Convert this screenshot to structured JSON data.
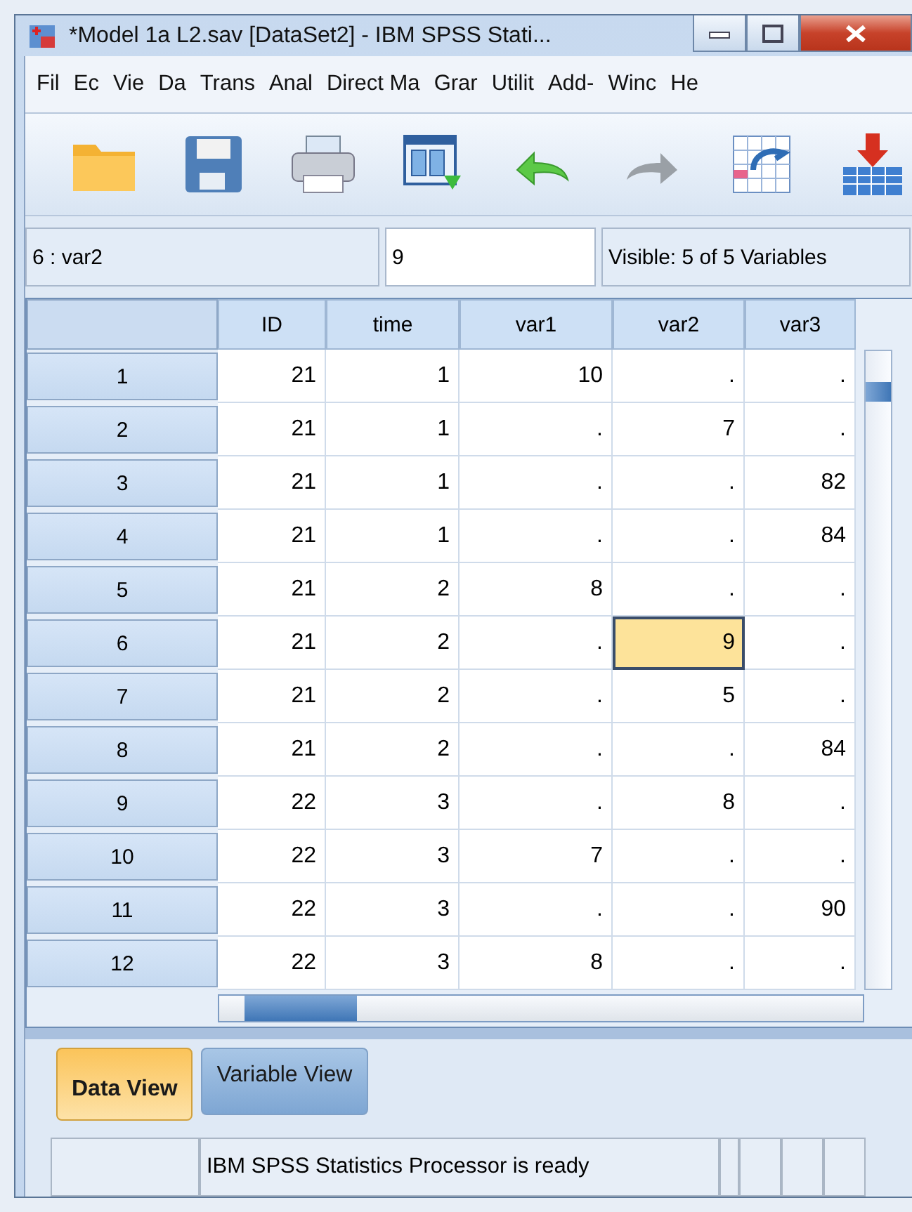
{
  "window": {
    "title": "*Model 1a L2.sav [DataSet2] - IBM SPSS Stati..."
  },
  "menu": [
    "Fil",
    "Ec",
    "Vie",
    "Da",
    "Trans",
    "Anal",
    "Direct Ma",
    "Grar",
    "Utilit",
    "Add-",
    "Winc",
    "He"
  ],
  "cell_info": {
    "reference": "6 : var2",
    "value": "9",
    "visible": "Visible: 5 of 5 Variables"
  },
  "table": {
    "columns": [
      "ID",
      "time",
      "var1",
      "var2",
      "var3"
    ],
    "rows": [
      {
        "label": "1",
        "cells": [
          {
            "text": "21",
            "selected": false
          },
          {
            "text": "1",
            "selected": false
          },
          {
            "text": "10",
            "selected": false
          },
          {
            "text": ".",
            "selected": false
          },
          {
            "text": ".",
            "selected": false
          }
        ]
      },
      {
        "label": "2",
        "cells": [
          {
            "text": "21",
            "selected": false
          },
          {
            "text": "1",
            "selected": false
          },
          {
            "text": ".",
            "selected": false
          },
          {
            "text": "7",
            "selected": false
          },
          {
            "text": ".",
            "selected": false
          }
        ]
      },
      {
        "label": "3",
        "cells": [
          {
            "text": "21",
            "selected": false
          },
          {
            "text": "1",
            "selected": false
          },
          {
            "text": ".",
            "selected": false
          },
          {
            "text": ".",
            "selected": false
          },
          {
            "text": "82",
            "selected": false
          }
        ]
      },
      {
        "label": "4",
        "cells": [
          {
            "text": "21",
            "selected": false
          },
          {
            "text": "1",
            "selected": false
          },
          {
            "text": ".",
            "selected": false
          },
          {
            "text": ".",
            "selected": false
          },
          {
            "text": "84",
            "selected": false
          }
        ]
      },
      {
        "label": "5",
        "cells": [
          {
            "text": "21",
            "selected": false
          },
          {
            "text": "2",
            "selected": false
          },
          {
            "text": "8",
            "selected": false
          },
          {
            "text": ".",
            "selected": false
          },
          {
            "text": ".",
            "selected": false
          }
        ]
      },
      {
        "label": "6",
        "cells": [
          {
            "text": "21",
            "selected": false
          },
          {
            "text": "2",
            "selected": false
          },
          {
            "text": ".",
            "selected": false
          },
          {
            "text": "9",
            "selected": true
          },
          {
            "text": ".",
            "selected": false
          }
        ]
      },
      {
        "label": "7",
        "cells": [
          {
            "text": "21",
            "selected": false
          },
          {
            "text": "2",
            "selected": false
          },
          {
            "text": ".",
            "selected": false
          },
          {
            "text": "5",
            "selected": false
          },
          {
            "text": ".",
            "selected": false
          }
        ]
      },
      {
        "label": "8",
        "cells": [
          {
            "text": "21",
            "selected": false
          },
          {
            "text": "2",
            "selected": false
          },
          {
            "text": ".",
            "selected": false
          },
          {
            "text": ".",
            "selected": false
          },
          {
            "text": "84",
            "selected": false
          }
        ]
      },
      {
        "label": "9",
        "cells": [
          {
            "text": "22",
            "selected": false
          },
          {
            "text": "3",
            "selected": false
          },
          {
            "text": ".",
            "selected": false
          },
          {
            "text": "8",
            "selected": false
          },
          {
            "text": ".",
            "selected": false
          }
        ]
      },
      {
        "label": "10",
        "cells": [
          {
            "text": "22",
            "selected": false
          },
          {
            "text": "3",
            "selected": false
          },
          {
            "text": "7",
            "selected": false
          },
          {
            "text": ".",
            "selected": false
          },
          {
            "text": ".",
            "selected": false
          }
        ]
      },
      {
        "label": "11",
        "cells": [
          {
            "text": "22",
            "selected": false
          },
          {
            "text": "3",
            "selected": false
          },
          {
            "text": ".",
            "selected": false
          },
          {
            "text": ".",
            "selected": false
          },
          {
            "text": "90",
            "selected": false
          }
        ]
      },
      {
        "label": "12",
        "cells": [
          {
            "text": "22",
            "selected": false
          },
          {
            "text": "3",
            "selected": false
          },
          {
            "text": "8",
            "selected": false
          },
          {
            "text": ".",
            "selected": false
          },
          {
            "text": ".",
            "selected": false
          }
        ]
      }
    ]
  },
  "tabs": [
    {
      "label": "Data View",
      "selected": true
    },
    {
      "label": "Variable View",
      "selected": false
    }
  ],
  "status_bar": {
    "message": "IBM SPSS Statistics Processor is ready"
  }
}
